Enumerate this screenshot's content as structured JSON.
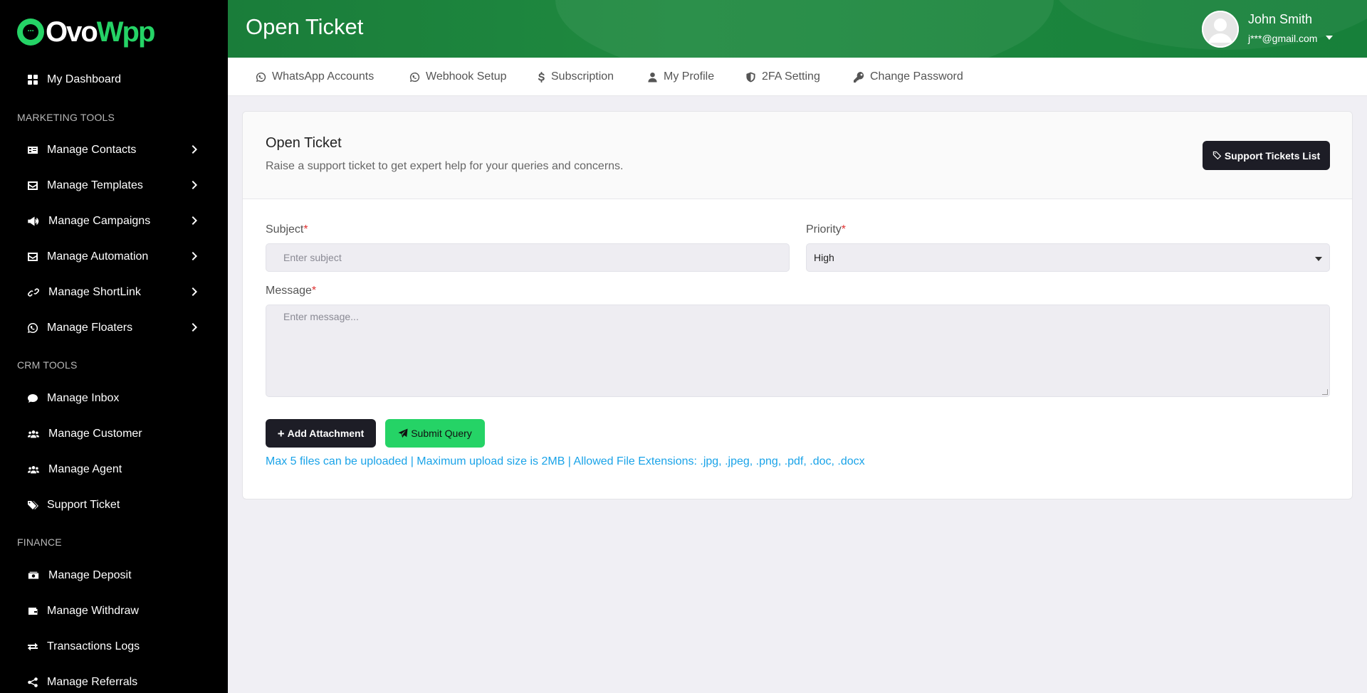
{
  "brand": {
    "logo_text_white": "Ovo",
    "logo_text_green": "Wpp",
    "logo_dots": "···"
  },
  "sidebar": {
    "dashboard": "My Dashboard",
    "section_marketing": "MARKETING TOOLS",
    "marketing_items": [
      {
        "label": "Manage Contacts",
        "icon": "contact-card-icon"
      },
      {
        "label": "Manage Templates",
        "icon": "envelope-icon"
      },
      {
        "label": "Manage Campaigns",
        "icon": "megaphone-icon"
      },
      {
        "label": "Manage Automation",
        "icon": "envelope-icon"
      },
      {
        "label": "Manage ShortLink",
        "icon": "link-icon"
      },
      {
        "label": "Manage Floaters",
        "icon": "whatsapp-icon"
      }
    ],
    "section_crm": "CRM TOOLS",
    "crm_items": [
      {
        "label": "Manage Inbox",
        "icon": "chat-icon"
      },
      {
        "label": "Manage Customer",
        "icon": "users-icon"
      },
      {
        "label": "Manage Agent",
        "icon": "users-icon"
      },
      {
        "label": "Support Ticket",
        "icon": "tags-icon"
      }
    ],
    "section_finance": "FINANCE",
    "finance_items": [
      {
        "label": "Manage Deposit",
        "icon": "cash-icon"
      },
      {
        "label": "Manage Withdraw",
        "icon": "wallet-icon"
      },
      {
        "label": "Transactions Logs",
        "icon": "exchange-icon"
      },
      {
        "label": "Manage Referrals",
        "icon": "share-icon"
      }
    ]
  },
  "header": {
    "title": "Open Ticket",
    "user_name": "John Smith",
    "user_email": "j***@gmail.com"
  },
  "subnav": [
    {
      "label": "WhatsApp Accounts",
      "icon": "whatsapp-icon"
    },
    {
      "label": "Webhook Setup",
      "icon": "whatsapp-icon"
    },
    {
      "label": "Subscription",
      "icon": "dollar-icon"
    },
    {
      "label": "My Profile",
      "icon": "user-icon"
    },
    {
      "label": "2FA Setting",
      "icon": "shield-icon"
    },
    {
      "label": "Change Password",
      "icon": "key-icon"
    }
  ],
  "card": {
    "title": "Open Ticket",
    "subtitle": "Raise a support ticket to get expert help for your queries and concerns.",
    "list_button": "Support Tickets List"
  },
  "form": {
    "subject_label": "Subject",
    "subject_placeholder": "Enter subject",
    "priority_label": "Priority",
    "priority_value": "High",
    "message_label": "Message",
    "message_placeholder": "Enter message...",
    "required_mark": "*",
    "attach_button": "Add Attachment",
    "attach_plus": "+",
    "submit_button": "Submit Query",
    "hint": "Max 5 files can be uploaded | Maximum upload size is 2MB | Allowed File Extensions: .jpg, .jpeg, .png, .pdf, .doc, .docx"
  },
  "colors": {
    "brand_green": "#25d366",
    "header_green": "#1a7d3a",
    "dark_button": "#1d1d26",
    "hint_blue": "#1aa3e8"
  }
}
